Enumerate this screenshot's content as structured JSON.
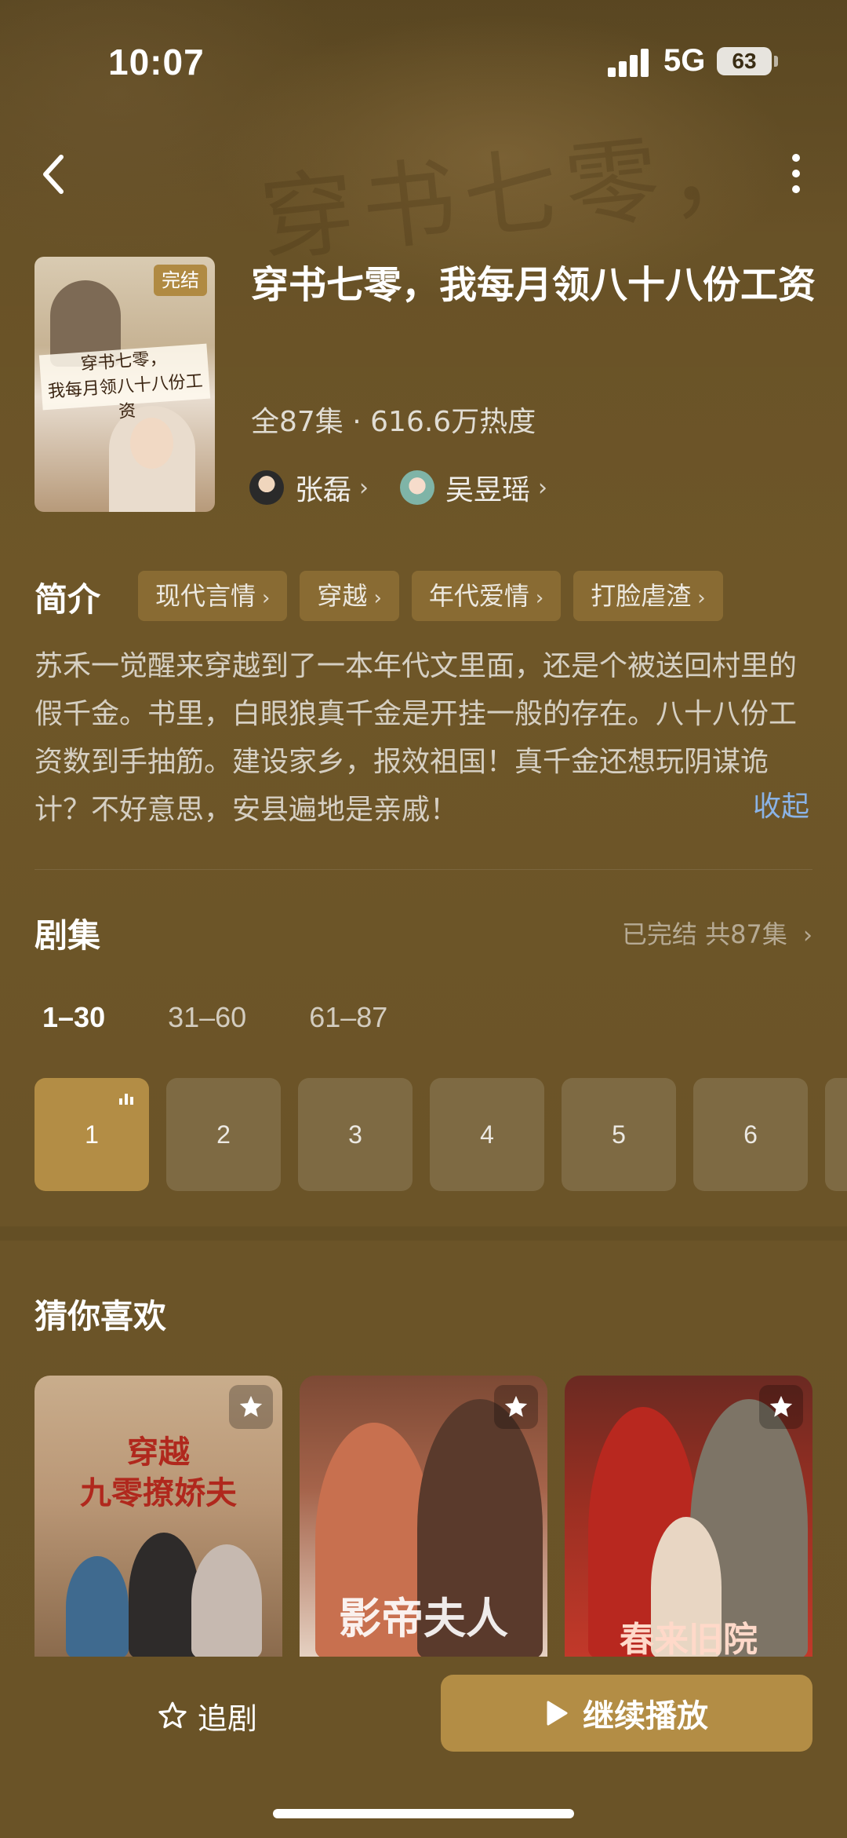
{
  "status_bar": {
    "time": "10:07",
    "network": "5G",
    "battery": "63"
  },
  "show": {
    "badge": "完结",
    "title": "穿书七零，我每月领八十八份工资",
    "meta": "全87集 · 616.6万热度",
    "cast": [
      {
        "name": "张磊"
      },
      {
        "name": "吴昱瑶"
      }
    ],
    "poster_text_1": "穿书七零，",
    "poster_text_2": "我每月领八十八份工资"
  },
  "intro": {
    "label": "简介",
    "tags": [
      "现代言情",
      "穿越",
      "年代爱情",
      "打脸虐渣"
    ],
    "description": "苏禾一觉醒来穿越到了一本年代文里面，还是个被送回村里的假千金。书里，白眼狼真千金是开挂一般的存在。八十八份工资数到手抽筋。建设家乡，报效祖国！真千金还想玩阴谋诡计？不好意思，安县遍地是亲戚！",
    "collapse_label": "收起"
  },
  "episodes": {
    "label": "剧集",
    "status": "已完结 共87集",
    "ranges": [
      "1–30",
      "31–60",
      "61–87"
    ],
    "active_range": 0,
    "items": [
      "1",
      "2",
      "3",
      "4",
      "5",
      "6"
    ],
    "active_item": 0
  },
  "recommend": {
    "label": "猜你喜欢",
    "cards": [
      {
        "title_line1": "穿越",
        "title_line2": "九零撩娇夫"
      },
      {
        "title_line1": "影帝夫人"
      },
      {
        "title_line1": "春来旧院"
      }
    ]
  },
  "bottom": {
    "follow_label": "追剧",
    "play_label": "继续播放"
  },
  "colors": {
    "accent": "#b38d45",
    "background": "#6b5428",
    "link": "#8ab3e6"
  }
}
